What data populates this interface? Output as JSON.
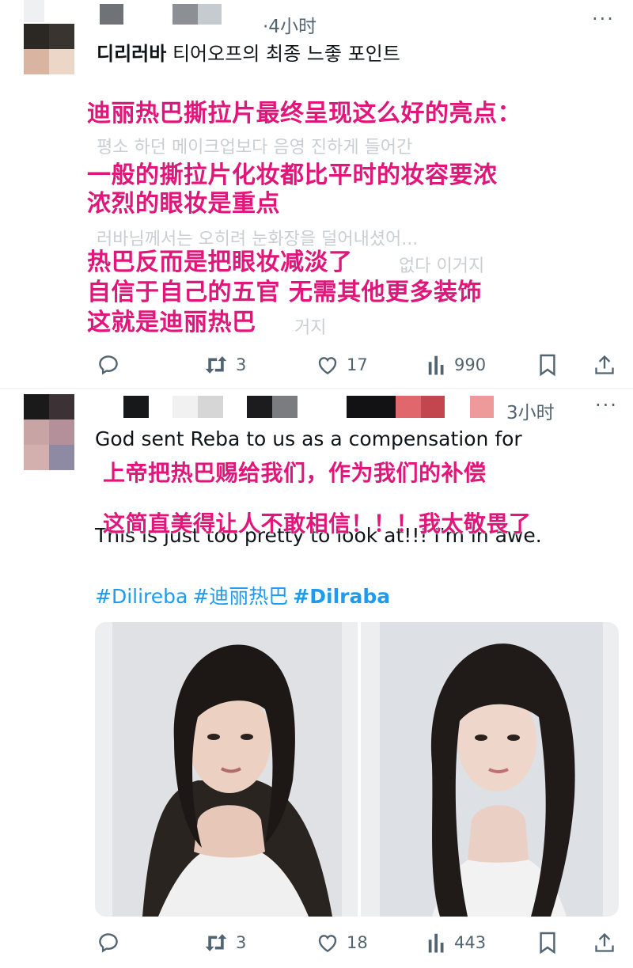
{
  "post1": {
    "time": "·4小时",
    "title_bold": "디리러바",
    "title_rest": " 티어오프의 최종 느좋 포인트",
    "faded_lines": [
      "평소 하던 메이크업보다 음영 진하게 들어간",
      "러바님께서는 오히려 눈화장을 덜어내셨어...",
      "없다 이거지",
      "거지"
    ],
    "overlay_lines": [
      "迪丽热巴撕拉片最终呈现这么好的亮点：",
      "一般的撕拉片化妆都比平时的妆容要浓",
      "浓烈的眼妆是重点",
      "热巴反而是把眼妆减淡了",
      "自信于自己的五官 无需其他更多装饰",
      "这就是迪丽热巴"
    ],
    "actions": {
      "reply": "",
      "retweet": "3",
      "like": "17",
      "views": "990"
    }
  },
  "post2": {
    "time": "3小时",
    "text_line1": "God sent Reba to us as a compensation for",
    "text_line3": "This is just too pretty to look at!!! I'm in awe.",
    "overlay_lines": [
      "上帝把热巴赐给我们，作为我们的补偿",
      "这简直美得让人不敢相信！！！我太敬畏了"
    ],
    "hashtags": [
      "#Dilireba",
      "#迪丽热巴",
      "#Dilraba"
    ],
    "actions": {
      "reply": "",
      "retweet": "3",
      "like": "18",
      "views": "443"
    }
  },
  "icons": [
    "reply-icon",
    "retweet-icon",
    "like-icon",
    "views-icon",
    "bookmark-icon",
    "share-icon",
    "more-icon"
  ],
  "colors": {
    "overlay_pink": "#e0167a",
    "link_blue": "#1d9bf0",
    "muted": "#536471"
  }
}
